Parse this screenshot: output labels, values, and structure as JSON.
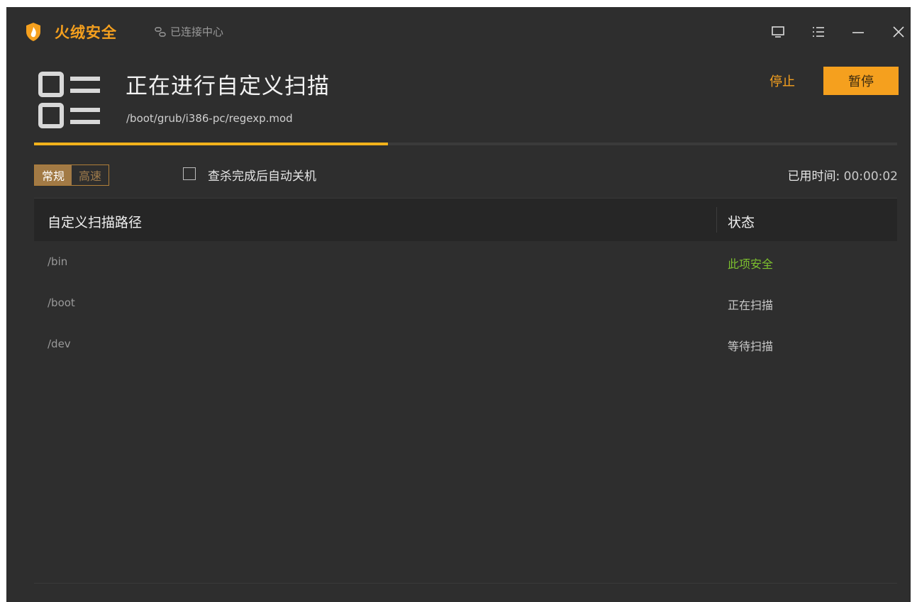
{
  "app": {
    "brand": "火绒安全",
    "connection_status": "已连接中心"
  },
  "window_controls": [
    "monitor-icon",
    "menu-icon",
    "minimize-icon",
    "close-icon"
  ],
  "scan": {
    "title": "正在进行自定义扫描",
    "current_file": "/boot/grub/i386-pc/regexp.mod",
    "progress_percent": 41,
    "stop_label": "停止",
    "pause_label": "暂停"
  },
  "options": {
    "mode_normal": "常规",
    "mode_fast": "高速",
    "selected_mode": "常规",
    "auto_shutdown_label": "查杀完成后自动关机",
    "auto_shutdown_checked": false,
    "elapsed_label": "已用时间:",
    "elapsed_value": "00:00:02"
  },
  "table": {
    "col_path": "自定义扫描路径",
    "col_status": "状态",
    "rows": [
      {
        "path": "/bin",
        "status": "此项安全"
      },
      {
        "path": "/boot",
        "status": "正在扫描"
      },
      {
        "path": "/dev",
        "status": "等待扫描"
      }
    ]
  },
  "colors": {
    "accent": "#f5a01e",
    "background": "#2e2e2e",
    "safe_status": "#7dc12e",
    "progress": "#f2b21b"
  }
}
